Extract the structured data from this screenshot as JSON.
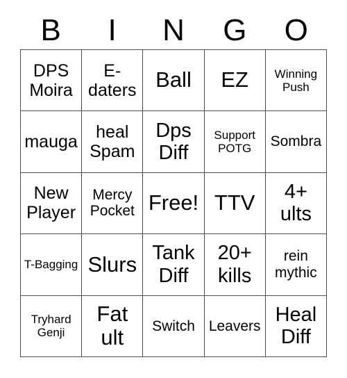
{
  "header": {
    "letters": [
      "B",
      "I",
      "N",
      "G",
      "O"
    ]
  },
  "grid": {
    "rows": 5,
    "columns": 5,
    "border_color": "#4d4d4d",
    "background_color": "#ffffff",
    "text_color": "#000000",
    "cells": [
      {
        "text": "DPS Moira",
        "size": "md"
      },
      {
        "text": "E-daters",
        "size": "md"
      },
      {
        "text": "Ball",
        "size": "xl"
      },
      {
        "text": "EZ",
        "size": "xl"
      },
      {
        "text": "Winning Push",
        "size": "xs"
      },
      {
        "text": "mauga",
        "size": "md"
      },
      {
        "text": "heal Spam",
        "size": "md"
      },
      {
        "text": "Dps Diff",
        "size": "lg"
      },
      {
        "text": "Support POTG",
        "size": "xs"
      },
      {
        "text": "Sombra",
        "size": "sm"
      },
      {
        "text": "New Player",
        "size": "md"
      },
      {
        "text": "Mercy Pocket",
        "size": "sm"
      },
      {
        "text": "Free!",
        "size": "xl"
      },
      {
        "text": "TTV",
        "size": "xl"
      },
      {
        "text": "4+ ults",
        "size": "lg"
      },
      {
        "text": "T-Bagging",
        "size": "xs"
      },
      {
        "text": "Slurs",
        "size": "xl"
      },
      {
        "text": "Tank Diff",
        "size": "lg"
      },
      {
        "text": "20+ kills",
        "size": "lg"
      },
      {
        "text": "rein mythic",
        "size": "sm"
      },
      {
        "text": "Tryhard Genji",
        "size": "xs"
      },
      {
        "text": "Fat ult",
        "size": "xl"
      },
      {
        "text": "Switch",
        "size": "sm"
      },
      {
        "text": "Leavers",
        "size": "sm"
      },
      {
        "text": "Heal Diff",
        "size": "lg"
      }
    ]
  }
}
